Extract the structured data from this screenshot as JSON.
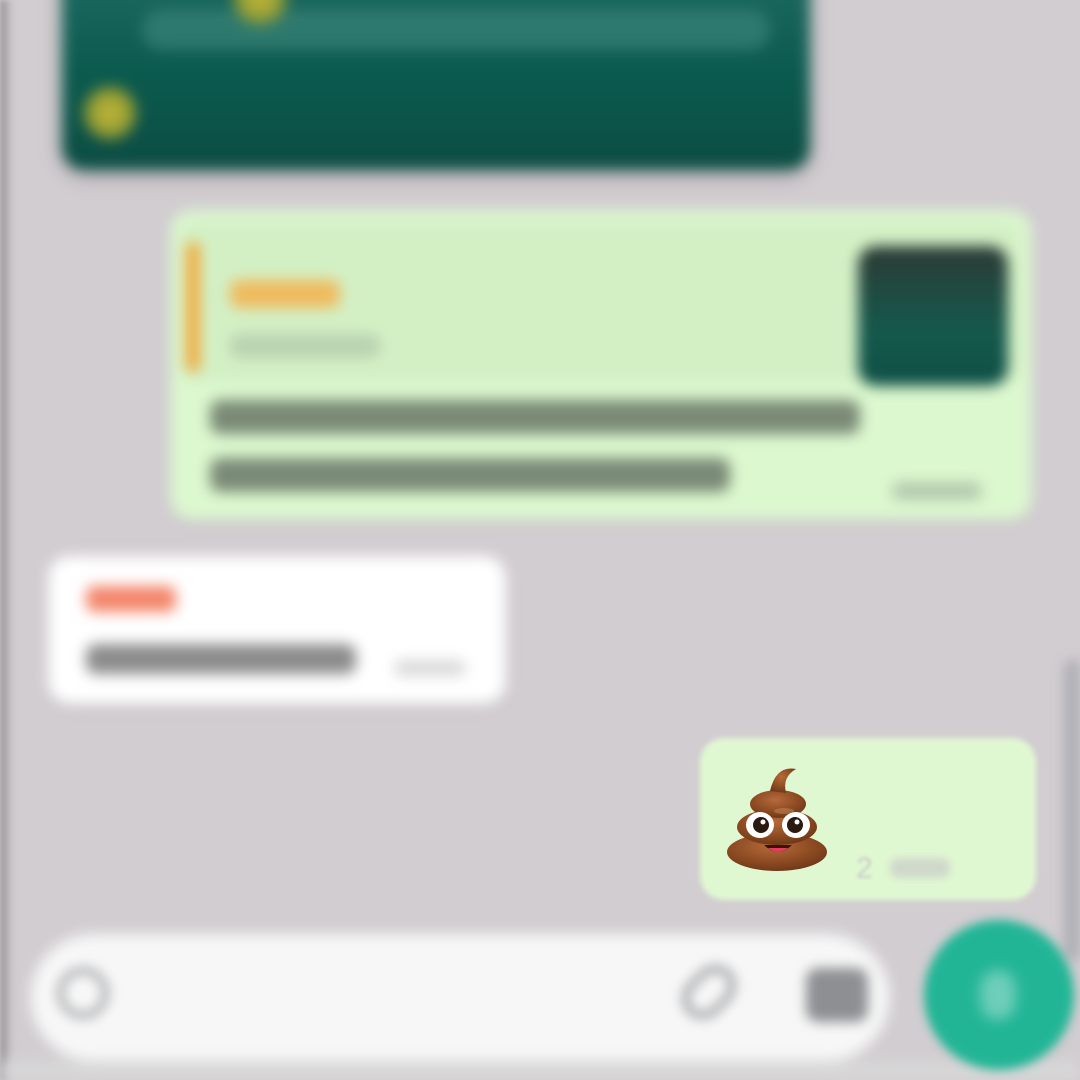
{
  "chat": {
    "sent_emoji_message": {
      "emoji": "💩",
      "time_fragment": "2"
    }
  },
  "composer": {
    "placeholder": "",
    "icons": {
      "emoji": "emoji-icon",
      "attach": "paperclip-icon",
      "camera": "camera-icon",
      "send": "mic-icon"
    }
  },
  "colors": {
    "background": "#d2cdd1",
    "outgoing_bubble": "#dcf8cf",
    "incoming_bubble": "#ffffff",
    "accent": "#21b596",
    "quote_bar": "#f1a93a",
    "sender_name": "#f3866b"
  }
}
